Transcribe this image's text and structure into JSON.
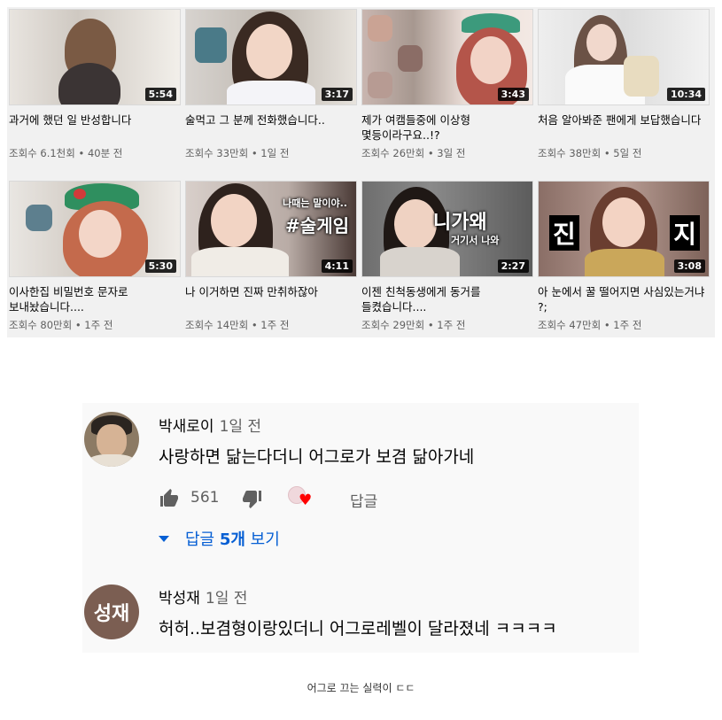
{
  "videos": [
    {
      "title": "과거에 했던 일 반성합니다",
      "meta": "조회수 6.1천회 • 40분 전",
      "duration": "5:54",
      "overlay": ""
    },
    {
      "title": "술먹고 그 분께 전화했습니다..",
      "meta": "조회수 33만회 • 1일 전",
      "duration": "3:17",
      "overlay": ""
    },
    {
      "title": "제가 여캠들중에 이상형 몇등이라구요..!?",
      "meta": "조회수 26만회 • 3일 전",
      "duration": "3:43",
      "overlay": ""
    },
    {
      "title": "처음 알아봐준 팬에게 보답했습니다",
      "meta": "조회수 38만회 • 5일 전",
      "duration": "10:34",
      "overlay": ""
    },
    {
      "title": "이사한집 비밀번호 문자로 보내놨습니다....",
      "meta": "조회수 80만회 • 1주 전",
      "duration": "5:30",
      "overlay": ""
    },
    {
      "title": "나 이거하면 진짜 만취하잖아",
      "meta": "조회수 14만회 • 1주 전",
      "duration": "4:11",
      "overlay": "나때는 말이야..",
      "overlay2": "#술게임"
    },
    {
      "title": "이젠 친척동생에게 동거를 들켰습니다....",
      "meta": "조회수 29만회 • 1주 전",
      "duration": "2:27",
      "overlay": "니가왜",
      "overlay2": "거기서 나와"
    },
    {
      "title": "아 눈에서 꿀 떨어지면 사심있는거냐 ?;",
      "meta": "조회수 47만회 • 1주 전",
      "duration": "3:08",
      "overlay": "진",
      "overlay2": "지"
    }
  ],
  "comments": [
    {
      "author": "박새로이",
      "time": "1일 전",
      "text": "사랑하면 닮는다더니 어그로가 보겸 닮아가네",
      "likes": "561",
      "reply_label": "답글",
      "view_replies_prefix": "답글 ",
      "view_replies_count": "5개",
      "view_replies_suffix": " 보기"
    },
    {
      "author": "박성재",
      "time": "1일 전",
      "avatar_initial": "성재",
      "text": "허허..보겸형이랑있더니 어그로레벨이 달라졌네 ㅋㅋㅋㅋ"
    }
  ],
  "caption": "어그로 끄는 실력이 ㄷㄷ",
  "colors": {
    "link_blue": "#065fd4",
    "heart_red": "#ff0000",
    "meta_gray": "#606060"
  }
}
